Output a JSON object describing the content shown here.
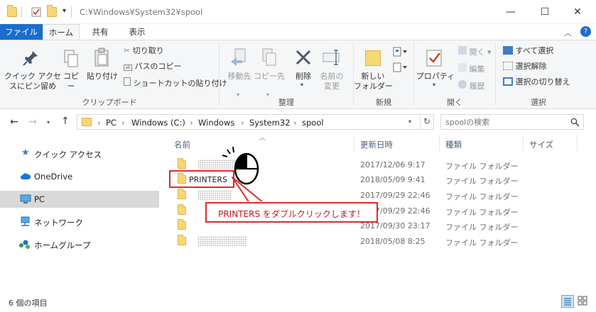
{
  "window": {
    "title": "C:¥Windows¥System32¥spool",
    "minimize": "—",
    "maximize": "☐",
    "close": "✕",
    "collapse_ribbon": "︿",
    "help": "?"
  },
  "tabs": [
    {
      "label": "ファイル"
    },
    {
      "label": "ホーム"
    },
    {
      "label": "共有"
    },
    {
      "label": "表示"
    }
  ],
  "ribbon": {
    "clipboard": {
      "group_label": "クリップボード",
      "pin_quick_access": "クイック アクセ\nスにピン留め",
      "copy": "コピー",
      "paste": "貼り付け",
      "cut": "切り取り",
      "copy_path": "パスのコピー",
      "paste_shortcut": "ショートカットの貼り付け"
    },
    "organize": {
      "group_label": "整理",
      "move_to": "移動先",
      "copy_to": "コピー先",
      "delete": "削除",
      "rename": "名前の\n変更"
    },
    "new": {
      "group_label": "新規",
      "new_folder": "新しい\nフォルダー"
    },
    "open": {
      "group_label": "開く",
      "properties": "プロパティ",
      "open": "開く",
      "edit": "編集",
      "history": "履歴"
    },
    "select": {
      "group_label": "選択",
      "select_all": "すべて選択",
      "select_none": "選択解除",
      "invert_selection": "選択の切り替え"
    }
  },
  "address": {
    "crumbs": [
      "PC",
      "Windows (C:)",
      "Windows",
      "System32",
      "spool"
    ],
    "search_placeholder": "spoolの検索"
  },
  "nav_pane": {
    "items": [
      {
        "label": "クイック アクセス",
        "icon": "star-icon"
      },
      {
        "label": "OneDrive",
        "icon": "cloud-icon"
      },
      {
        "label": "PC",
        "icon": "computer-icon",
        "selected": true
      },
      {
        "label": "ネットワーク",
        "icon": "network-icon"
      },
      {
        "label": "ホームグループ",
        "icon": "homegroup-icon"
      }
    ]
  },
  "file_list": {
    "columns": {
      "name": "名前",
      "modified": "更新日時",
      "type": "種類",
      "size": "サイズ"
    },
    "rows": [
      {
        "name": "",
        "modified": "2017/12/06 9:17",
        "type": "ファイル フォルダー"
      },
      {
        "name": "PRINTERS",
        "modified": "2018/05/09 9:41",
        "type": "ファイル フォルダー"
      },
      {
        "name": "",
        "modified": "2017/09/29 22:46",
        "type": "ファイル フォルダー"
      },
      {
        "name": "",
        "modified": "2017/09/29 22:46",
        "type": "ファイル フォルダー"
      },
      {
        "name": "",
        "modified": "2017/09/30 23:17",
        "type": "ファイル フォルダー"
      },
      {
        "name": "",
        "modified": "2018/05/08 8:25",
        "type": "ファイル フォルダー"
      }
    ]
  },
  "status": {
    "item_count": "6 個の項目"
  },
  "annotation": {
    "callout": "PRINTERS をダブルクリックします！"
  },
  "colors": {
    "file_tab": "#1a6dcb",
    "annotation_red": "#e02a2a",
    "folder_yellow": "#f8d775"
  }
}
